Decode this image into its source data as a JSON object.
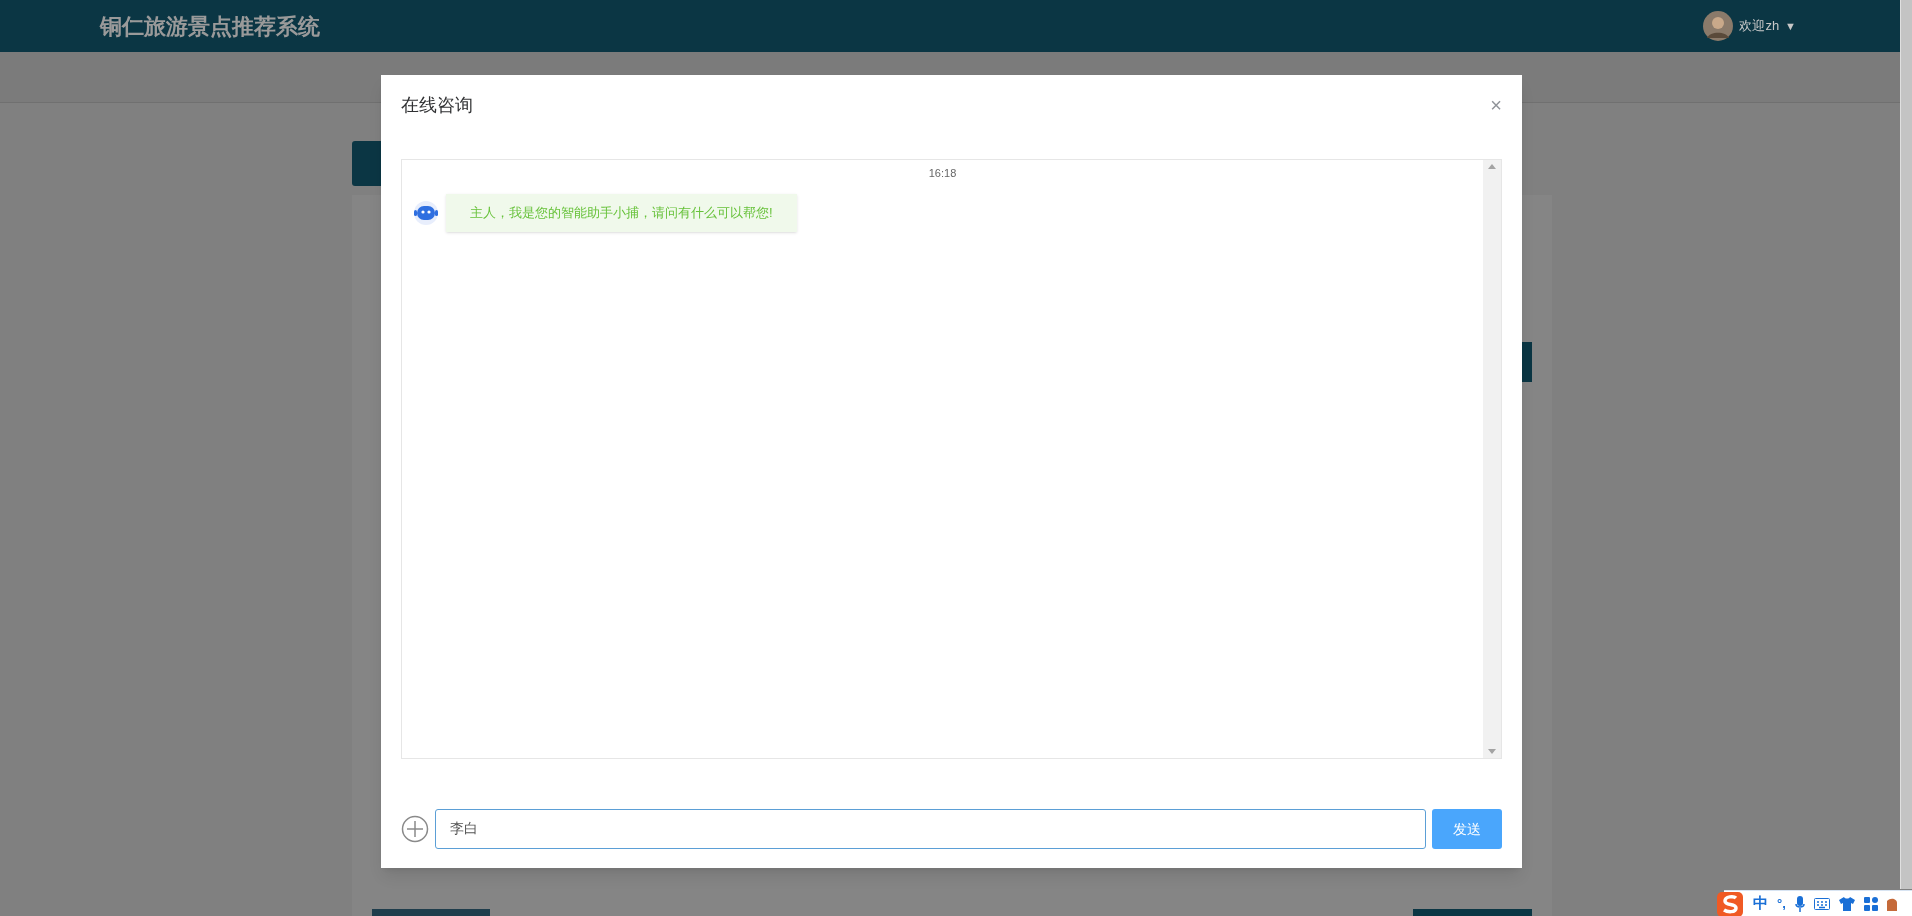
{
  "header": {
    "title": "铜仁旅游景点推荐系统",
    "user": {
      "greeting": "欢迎zh",
      "caret": "▼"
    }
  },
  "dialog": {
    "title": "在线咨询",
    "close": "×",
    "chat": {
      "time": "16:18",
      "messages": [
        {
          "kind": "bot",
          "text": "主人，我是您的智能助手小捕，请问有什么可以帮您!"
        }
      ]
    },
    "input": {
      "value": "李白"
    },
    "send_button": "发送"
  },
  "ime_bar": {
    "language": "中",
    "punctuation": "°,"
  }
}
